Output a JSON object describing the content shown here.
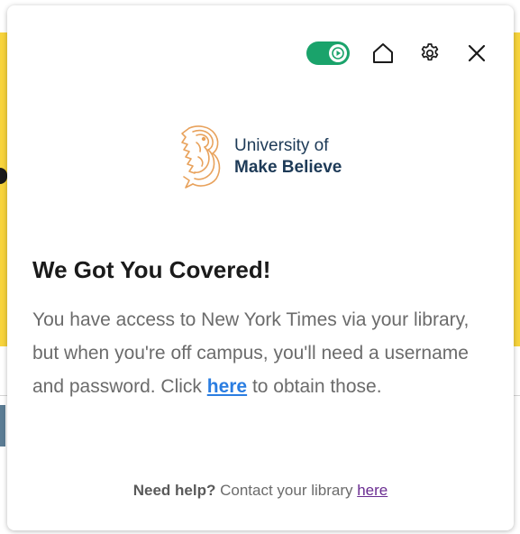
{
  "colors": {
    "toggle_on": "#1aa36b",
    "logo_orange": "#e8a25c",
    "logo_text": "#1d3a57",
    "link_blue": "#2a7de1",
    "link_visited": "#6a2c91",
    "background_yellow": "#f7d43c"
  },
  "toolbar": {
    "toggle_state": "on",
    "toggle_icon": "play-icon",
    "home_icon": "home-icon",
    "settings_icon": "gear-icon",
    "close_icon": "close-icon"
  },
  "logo": {
    "line1": "University of",
    "line2": "Make Believe",
    "icon": "seahorse-logo-icon"
  },
  "main": {
    "heading": "We Got You Covered!",
    "body_before_link": "You have access to New York Times via your library, but when you're off campus, you'll need a username and password. Click ",
    "link_text": "here",
    "body_after_link": " to obtain those."
  },
  "footer": {
    "help_label": "Need help?",
    "help_text": " Contact your library ",
    "link_text": "here"
  }
}
